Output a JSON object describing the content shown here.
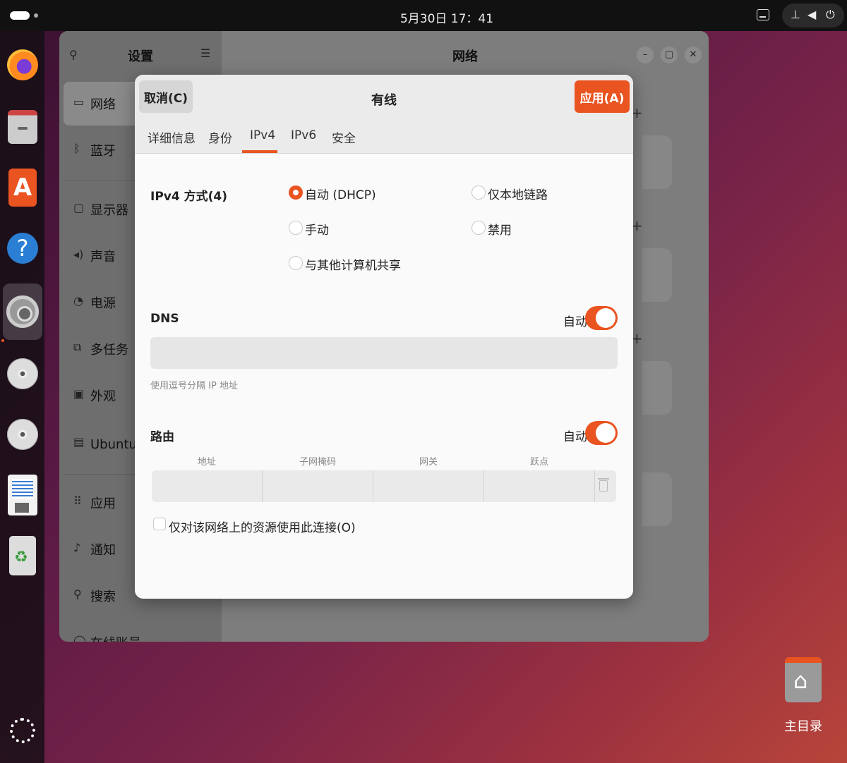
{
  "topbar": {
    "clock": "5月30日 17：41",
    "tray_icons": [
      "network-icon",
      "volume-icon",
      "power-icon"
    ]
  },
  "dock": {
    "items": [
      "firefox-icon",
      "files-icon",
      "app-center-icon",
      "help-icon",
      "settings-icon",
      "disc-icon",
      "disc-icon",
      "text-editor-icon",
      "trash-icon",
      "show-apps-icon"
    ]
  },
  "settings": {
    "sidebar_title": "设置",
    "main_title": "网络",
    "sidebar": {
      "items": [
        {
          "label": "网络",
          "icon": "network-icon"
        },
        {
          "label": "蓝牙",
          "icon": "bluetooth-icon"
        },
        {
          "label": "显示器",
          "icon": "display-icon"
        },
        {
          "label": "声音",
          "icon": "sound-icon"
        },
        {
          "label": "电源",
          "icon": "power-icon"
        },
        {
          "label": "多任务",
          "icon": "multitasking-icon"
        },
        {
          "label": "外观",
          "icon": "appearance-icon"
        },
        {
          "label": "Ubuntu 桌",
          "icon": "ubuntu-desktop-icon"
        },
        {
          "label": "应用",
          "icon": "apps-icon"
        },
        {
          "label": "通知",
          "icon": "bell-icon"
        },
        {
          "label": "搜索",
          "icon": "search-icon"
        },
        {
          "label": "在线账号",
          "icon": "accounts-icon"
        }
      ]
    }
  },
  "dialog": {
    "title": "有线",
    "cancel_label": "取消(C)",
    "apply_label": "应用(A)",
    "tabs": [
      "详细信息",
      "身份",
      "IPv4",
      "IPv6",
      "安全"
    ],
    "active_tab": "IPv4",
    "ipv4_method_label": "IPv4 方式(4)",
    "methods": {
      "auto": "自动 (DHCP)",
      "link_local": "仅本地链路",
      "manual": "手动",
      "disabled": "禁用",
      "shared": "与其他计算机共享"
    },
    "selected_method": "auto",
    "dns": {
      "label": "DNS",
      "toggle_label": "自动",
      "toggle_on": true,
      "value": "",
      "hint": "使用逗号分隔 IP 地址"
    },
    "routes": {
      "label": "路由",
      "toggle_label": "自动",
      "toggle_on": true,
      "columns": [
        "地址",
        "子网掩码",
        "网关",
        "跃点"
      ]
    },
    "restrict_label": "仅对该网络上的资源使用此连接(O)",
    "restrict_checked": false
  },
  "desktop": {
    "home_label": "主目录"
  },
  "colors": {
    "accent": "#e95420"
  }
}
